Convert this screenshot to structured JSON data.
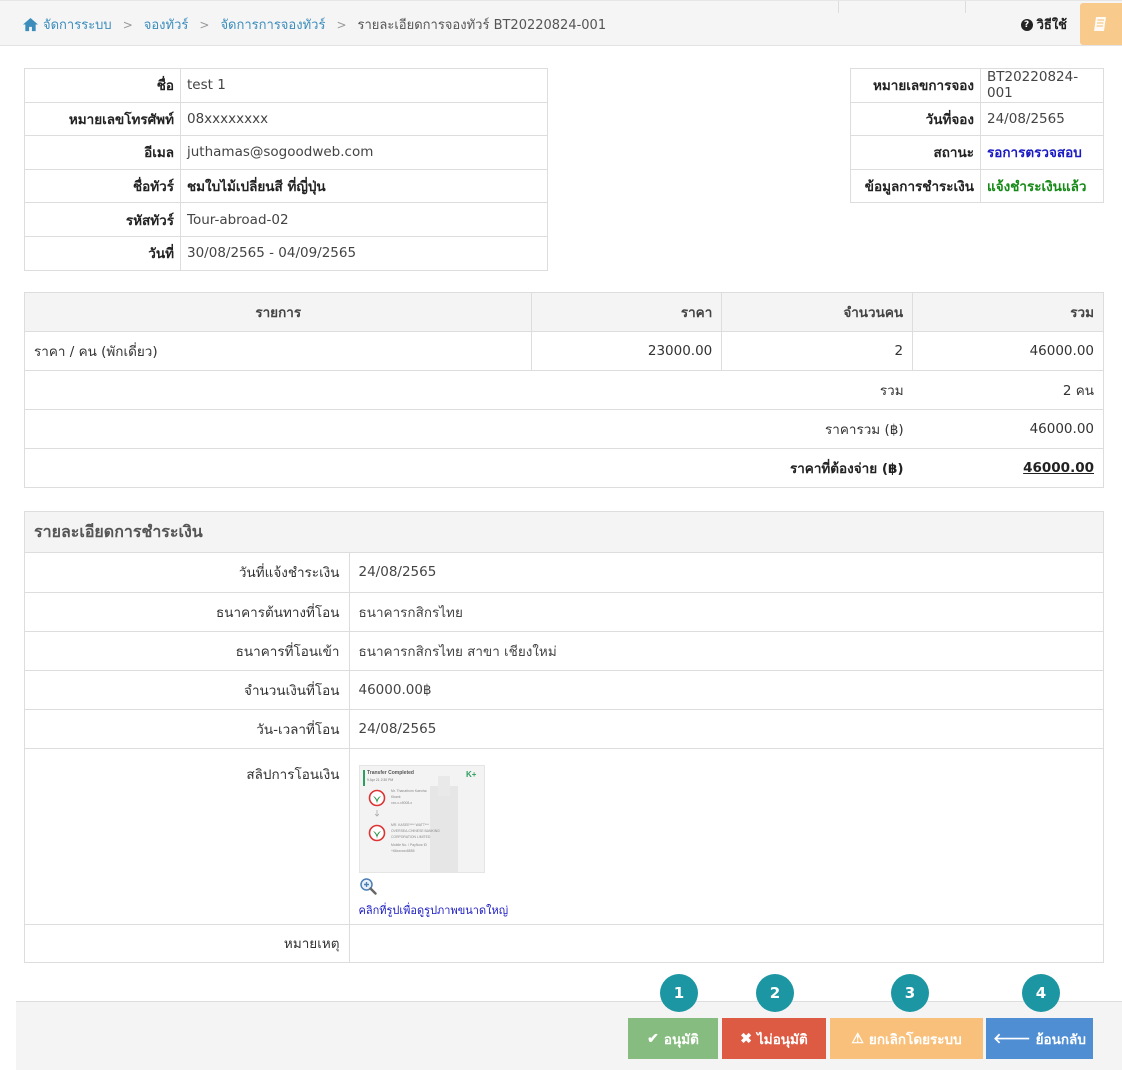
{
  "breadcrumb": {
    "home": "จัดการระบบ",
    "items": [
      "จองทัวร์",
      "จัดการการจองทัวร์"
    ],
    "current": "รายละเอียดการจองทัวร์ BT20220824-001"
  },
  "help_label": "วิธีใช้",
  "customer": {
    "rows": [
      {
        "label": "ชื่อ",
        "value": "test 1"
      },
      {
        "label": "หมายเลขโทรศัพท์",
        "value": "08xxxxxxxx"
      },
      {
        "label": "อีเมล",
        "value": "juthamas@sogoodweb.com"
      },
      {
        "label": "ชื่อทัวร์",
        "value": "ชมใบไม้เปลี่ยนสี ที่ญี่ปุ่น"
      },
      {
        "label": "รหัสทัวร์",
        "value": "Tour-abroad-02"
      },
      {
        "label": "วันที่",
        "value": "30/08/2565 - 04/09/2565"
      }
    ]
  },
  "booking": {
    "rows": [
      {
        "label": "หมายเลขการจอง",
        "value": "BT20220824-001"
      },
      {
        "label": "วันที่จอง",
        "value": "24/08/2565"
      },
      {
        "label": "สถานะ",
        "value": "รอการตรวจสอบ"
      },
      {
        "label": "ข้อมูลการชำระเงิน",
        "value": "แจ้งชำระเงินแล้ว"
      }
    ],
    "status_color": "#1a1ac4",
    "payment_color": "#168a16"
  },
  "price_table": {
    "headers": [
      "รายการ",
      "ราคา",
      "จำนวนคน",
      "รวม"
    ],
    "rows": [
      {
        "item": "ราคา / คน (พักเดี่ยว)",
        "price": "23000.00",
        "qty": "2",
        "total": "46000.00"
      }
    ],
    "summary": [
      {
        "label": "รวม",
        "value": "2 คน"
      },
      {
        "label": "ราคารวม (฿)",
        "value": "46000.00"
      },
      {
        "label": "ราคาที่ต้องจ่าย (฿)",
        "value": "46000.00"
      }
    ]
  },
  "payment": {
    "title": "รายละเอียดการชำระเงิน",
    "rows": [
      {
        "label": "วันที่แจ้งชำระเงิน",
        "value": "24/08/2565"
      },
      {
        "label": "ธนาคารต้นทางที่โอน",
        "value": "ธนาคารกสิกรไทย"
      },
      {
        "label": "ธนาคารที่โอนเข้า",
        "value": "ธนาคารกสิกรไทย สาขา เชียงใหม่"
      },
      {
        "label": "จำนวนเงินที่โอน",
        "value": "46000.00฿"
      },
      {
        "label": "วัน-เวลาที่โอน",
        "value": "24/08/2565"
      }
    ],
    "slip_label": "สลิปการโอนเงิน",
    "slip_link": "คลิกที่รูปเพื่อดูรูปภาพขนาดใหญ่",
    "slip_image": {
      "heading": "Transfer Completed",
      "date": "9 Apr 21  2:30 PM",
      "brand": "K+",
      "from_name": "Mr. Thanathorn Kaeoha",
      "from_bank": "Kbank",
      "from_acct": "xxx-x-x5008-x",
      "to_name": "MR. KASEE**** WATT***",
      "to_bank_1": "OVERSEA-CHINESE BANKING",
      "to_bank_2": "CORPORATION LIMITED",
      "to_mobile": "Mobile No. / PayNow ID",
      "to_number": "+66xxxxxx8855"
    },
    "note_label": "หมายเหตุ",
    "note_value": ""
  },
  "actions": {
    "approve": "อนุมัติ",
    "reject": "ไม่อนุมัติ",
    "cancel": "ยกเลิกโดยระบบ",
    "back": "ย้อนกลับ"
  },
  "markers": [
    "1",
    "2",
    "3",
    "4"
  ],
  "colors": {
    "approve": "#86bc7f",
    "reject": "#dd5a43",
    "cancel": "#f8c07a",
    "back": "#4f8ed3",
    "marker": "#1d96a3",
    "link": "#3c8dbc"
  }
}
